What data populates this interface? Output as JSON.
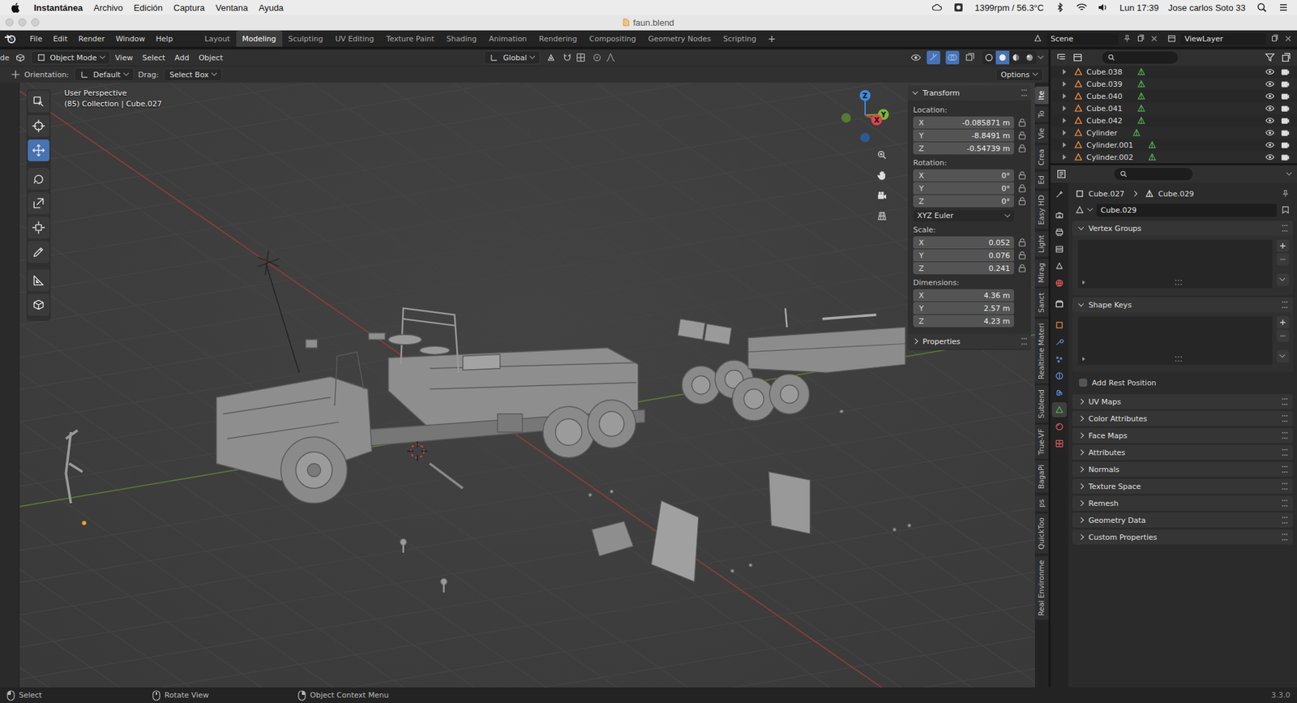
{
  "mac_menu_bar": {
    "app": "Instantánea",
    "menus": [
      "Archivo",
      "Edición",
      "Captura",
      "Ventana",
      "Ayuda"
    ],
    "sensor": "1399rpm / 56.3°C",
    "clock": "Lun 17:39",
    "user": "Jose carlos Soto 33"
  },
  "window": {
    "title": "faun.blend"
  },
  "top_bar": {
    "menus": [
      "File",
      "Edit",
      "Render",
      "Window",
      "Help"
    ],
    "workspaces": [
      {
        "label": "Layout",
        "selected": false
      },
      {
        "label": "Modeling",
        "selected": true
      },
      {
        "label": "Sculpting",
        "selected": false
      },
      {
        "label": "UV Editing",
        "selected": false
      },
      {
        "label": "Texture Paint",
        "selected": false
      },
      {
        "label": "Shading",
        "selected": false
      },
      {
        "label": "Animation",
        "selected": false
      },
      {
        "label": "Rendering",
        "selected": false
      },
      {
        "label": "Compositing",
        "selected": false
      },
      {
        "label": "Geometry Nodes",
        "selected": false
      },
      {
        "label": "Scripting",
        "selected": false
      }
    ],
    "add_workspace": "+",
    "scene": "Scene",
    "view_layer": "ViewLayer"
  },
  "viewport_header": {
    "cut_label": "de",
    "mode": "Object Mode",
    "menus": [
      "View",
      "Select",
      "Add",
      "Object"
    ],
    "orientation": "Global"
  },
  "tool_settings": {
    "orientation_label": "Orientation:",
    "orientation": "Default",
    "drag_label": "Drag:",
    "drag": "Select Box",
    "options": "Options"
  },
  "viewport": {
    "perspective": "User Perspective",
    "info": "(85) Collection | Cube.027",
    "gizmo": {
      "x": "X",
      "y": "Y",
      "z": "Z"
    }
  },
  "toolbar": [
    {
      "kind": "select",
      "selected": false
    },
    {
      "kind": "cursor",
      "selected": false
    },
    {
      "kind": "move",
      "selected": true
    },
    {
      "kind": "rotate",
      "selected": false
    },
    {
      "kind": "scale",
      "selected": false
    },
    {
      "kind": "transform",
      "selected": false
    },
    {
      "kind": "annotate",
      "selected": false
    },
    {
      "kind": "measure",
      "selected": false
    },
    {
      "kind": "add-cube",
      "selected": false
    }
  ],
  "shading": [
    {
      "kind": "wireframe",
      "selected": false
    },
    {
      "kind": "solid",
      "selected": true
    },
    {
      "kind": "material",
      "selected": false
    },
    {
      "kind": "rendered",
      "selected": false
    }
  ],
  "n_panel": {
    "transform": {
      "title": "Transform",
      "expanded": true,
      "groups": [
        {
          "label": "Location:",
          "lockable": true,
          "fields": [
            {
              "axis": "X",
              "value": "-0.085871 m"
            },
            {
              "axis": "Y",
              "value": "-8.8491 m"
            },
            {
              "axis": "Z",
              "value": "-0.54739 m"
            }
          ]
        },
        {
          "label": "Rotation:",
          "lockable": true,
          "fields": [
            {
              "axis": "X",
              "value": "0°"
            },
            {
              "axis": "Y",
              "value": "0°"
            },
            {
              "axis": "Z",
              "value": "0°"
            }
          ],
          "mode": "XYZ Euler"
        },
        {
          "label": "Scale:",
          "lockable": true,
          "fields": [
            {
              "axis": "X",
              "value": "0.052"
            },
            {
              "axis": "Y",
              "value": "0.076"
            },
            {
              "axis": "Z",
              "value": "0.241"
            }
          ]
        },
        {
          "label": "Dimensions:",
          "lockable": false,
          "fields": [
            {
              "axis": "X",
              "value": "4.36 m"
            },
            {
              "axis": "Y",
              "value": "2.57 m"
            },
            {
              "axis": "Z",
              "value": "4.23 m"
            }
          ]
        }
      ]
    },
    "properties": {
      "title": "Properties",
      "expanded": false
    }
  },
  "side_tabs": [
    {
      "label": "Ite",
      "selected": true
    },
    {
      "label": "To",
      "selected": false
    },
    {
      "label": "Vie",
      "selected": false
    },
    {
      "label": "Crea",
      "selected": false
    },
    {
      "label": "Ed",
      "selected": false
    },
    {
      "label": "Easy HD",
      "selected": false
    },
    {
      "label": "Light",
      "selected": false
    },
    {
      "label": "Mirag",
      "selected": false
    },
    {
      "label": "Sanct",
      "selected": false
    },
    {
      "label": "Realtime Materi",
      "selected": false
    },
    {
      "label": "Sublend",
      "selected": false
    },
    {
      "label": "True-VF",
      "selected": false
    },
    {
      "label": "BagaPi",
      "selected": false
    },
    {
      "label": "ps",
      "selected": false
    },
    {
      "label": "QuickToo",
      "selected": false
    },
    {
      "label": "Real Environme",
      "selected": false
    }
  ],
  "outliner": {
    "rows": [
      {
        "name": "Cube.038",
        "visible": true,
        "renderable": true
      },
      {
        "name": "Cube.039",
        "visible": true,
        "renderable": true
      },
      {
        "name": "Cube.040",
        "visible": true,
        "renderable": true
      },
      {
        "name": "Cube.041",
        "visible": true,
        "renderable": true
      },
      {
        "name": "Cube.042",
        "visible": true,
        "renderable": true
      },
      {
        "name": "Cylinder",
        "visible": true,
        "renderable": true
      },
      {
        "name": "Cylinder.001",
        "visible": true,
        "renderable": true
      },
      {
        "name": "Cylinder.002",
        "visible": true,
        "renderable": true
      }
    ]
  },
  "properties": {
    "tabs": [
      {
        "kind": "tool",
        "selected": false
      },
      {
        "kind": "render",
        "selected": false
      },
      {
        "kind": "output",
        "selected": false
      },
      {
        "kind": "view-layer",
        "selected": false
      },
      {
        "kind": "scene",
        "selected": false
      },
      {
        "kind": "world",
        "selected": false
      },
      {
        "kind": "collection",
        "selected": false
      },
      {
        "kind": "object",
        "selected": false
      },
      {
        "kind": "modifiers",
        "selected": false
      },
      {
        "kind": "particles",
        "selected": false
      },
      {
        "kind": "physics",
        "selected": false
      },
      {
        "kind": "constraints",
        "selected": false
      },
      {
        "kind": "data",
        "selected": true
      },
      {
        "kind": "material",
        "selected": false
      },
      {
        "kind": "texture",
        "selected": false
      }
    ],
    "breadcrumb": [
      "Cube.027",
      "Cube.029"
    ],
    "mesh_name": "Cube.029",
    "sections": [
      {
        "kind": "list",
        "label": "Vertex Groups",
        "expanded": true
      },
      {
        "kind": "list",
        "label": "Shape Keys",
        "expanded": true
      },
      {
        "kind": "checkbox",
        "label": "Add Rest Position",
        "checked": false
      },
      {
        "kind": "panel",
        "label": "UV Maps",
        "expanded": false
      },
      {
        "kind": "panel",
        "label": "Color Attributes",
        "expanded": false
      },
      {
        "kind": "panel",
        "label": "Face Maps",
        "expanded": false
      },
      {
        "kind": "panel",
        "label": "Attributes",
        "expanded": false
      },
      {
        "kind": "panel",
        "label": "Normals",
        "expanded": false
      },
      {
        "kind": "panel",
        "label": "Texture Space",
        "expanded": false
      },
      {
        "kind": "panel",
        "label": "Remesh",
        "expanded": false
      },
      {
        "kind": "panel",
        "label": "Geometry Data",
        "expanded": false
      },
      {
        "kind": "panel",
        "label": "Custom Properties",
        "expanded": false
      }
    ]
  },
  "status_bar": {
    "hints": [
      {
        "kind": "left-click",
        "label": "Select"
      },
      {
        "kind": "middle-click",
        "label": "Rotate View"
      },
      {
        "kind": "right-click",
        "label": "Object Context Menu"
      }
    ],
    "version": "3.3.0"
  }
}
